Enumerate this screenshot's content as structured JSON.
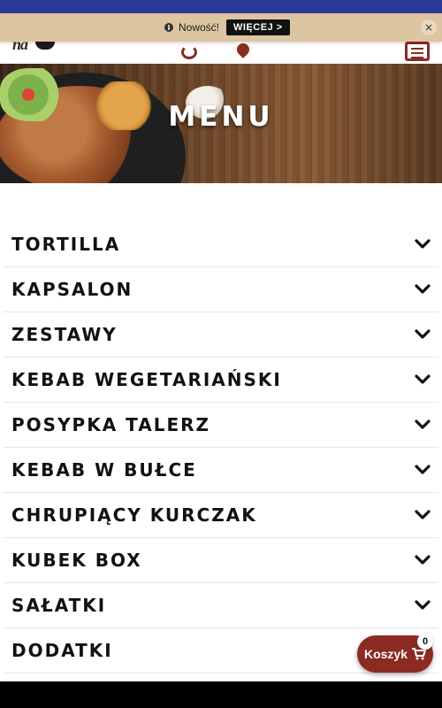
{
  "notice": {
    "text": "Nowość!",
    "more_label": "WIĘCEJ",
    "more_arrow": ">",
    "close_label": "×"
  },
  "hero": {
    "title": "MENU"
  },
  "menu": {
    "items": [
      {
        "label": "TORTILLA"
      },
      {
        "label": "KAPSALON"
      },
      {
        "label": "ZESTAWY"
      },
      {
        "label": "KEBAB WEGETARIAŃSKI"
      },
      {
        "label": "POSYPKA TALERZ"
      },
      {
        "label": "KEBAB W BUŁCE"
      },
      {
        "label": "CHRUPIĄCY KURCZAK"
      },
      {
        "label": "KUBEK BOX"
      },
      {
        "label": "SAŁATKI"
      },
      {
        "label": "DODATKI"
      }
    ]
  },
  "cart": {
    "label": "Koszyk",
    "count": "0"
  },
  "colors": {
    "topbar": "#2b3a97",
    "notice_bg": "#dcc5a0",
    "accent": "#8b2b21",
    "text": "#111111"
  },
  "icons": {
    "chevron": "chevron-down-icon",
    "cart": "cart-icon",
    "info": "info-icon",
    "close": "close-icon"
  }
}
